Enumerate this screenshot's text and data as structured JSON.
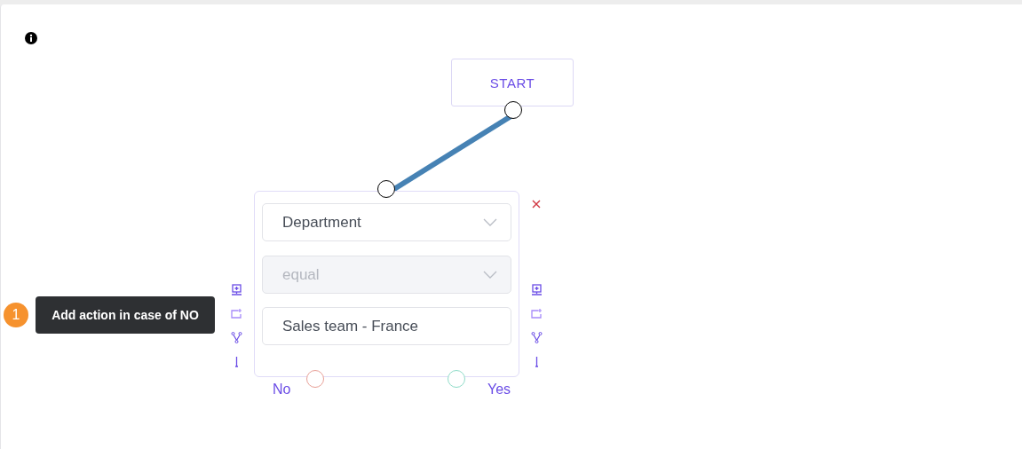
{
  "start_node": {
    "label": "START"
  },
  "condition_node": {
    "fields": [
      {
        "kind": "select",
        "value": "Department",
        "disabled": false
      },
      {
        "kind": "select",
        "value": "equal",
        "disabled": true
      },
      {
        "kind": "input",
        "value": "Sales team - France",
        "disabled": false
      }
    ],
    "outputs": [
      {
        "label": "No",
        "color": "#e8a097"
      },
      {
        "label": "Yes",
        "color": "#8fdcc8"
      }
    ]
  },
  "tour_tooltip": {
    "step": "1",
    "text": "Add action in case of NO"
  }
}
